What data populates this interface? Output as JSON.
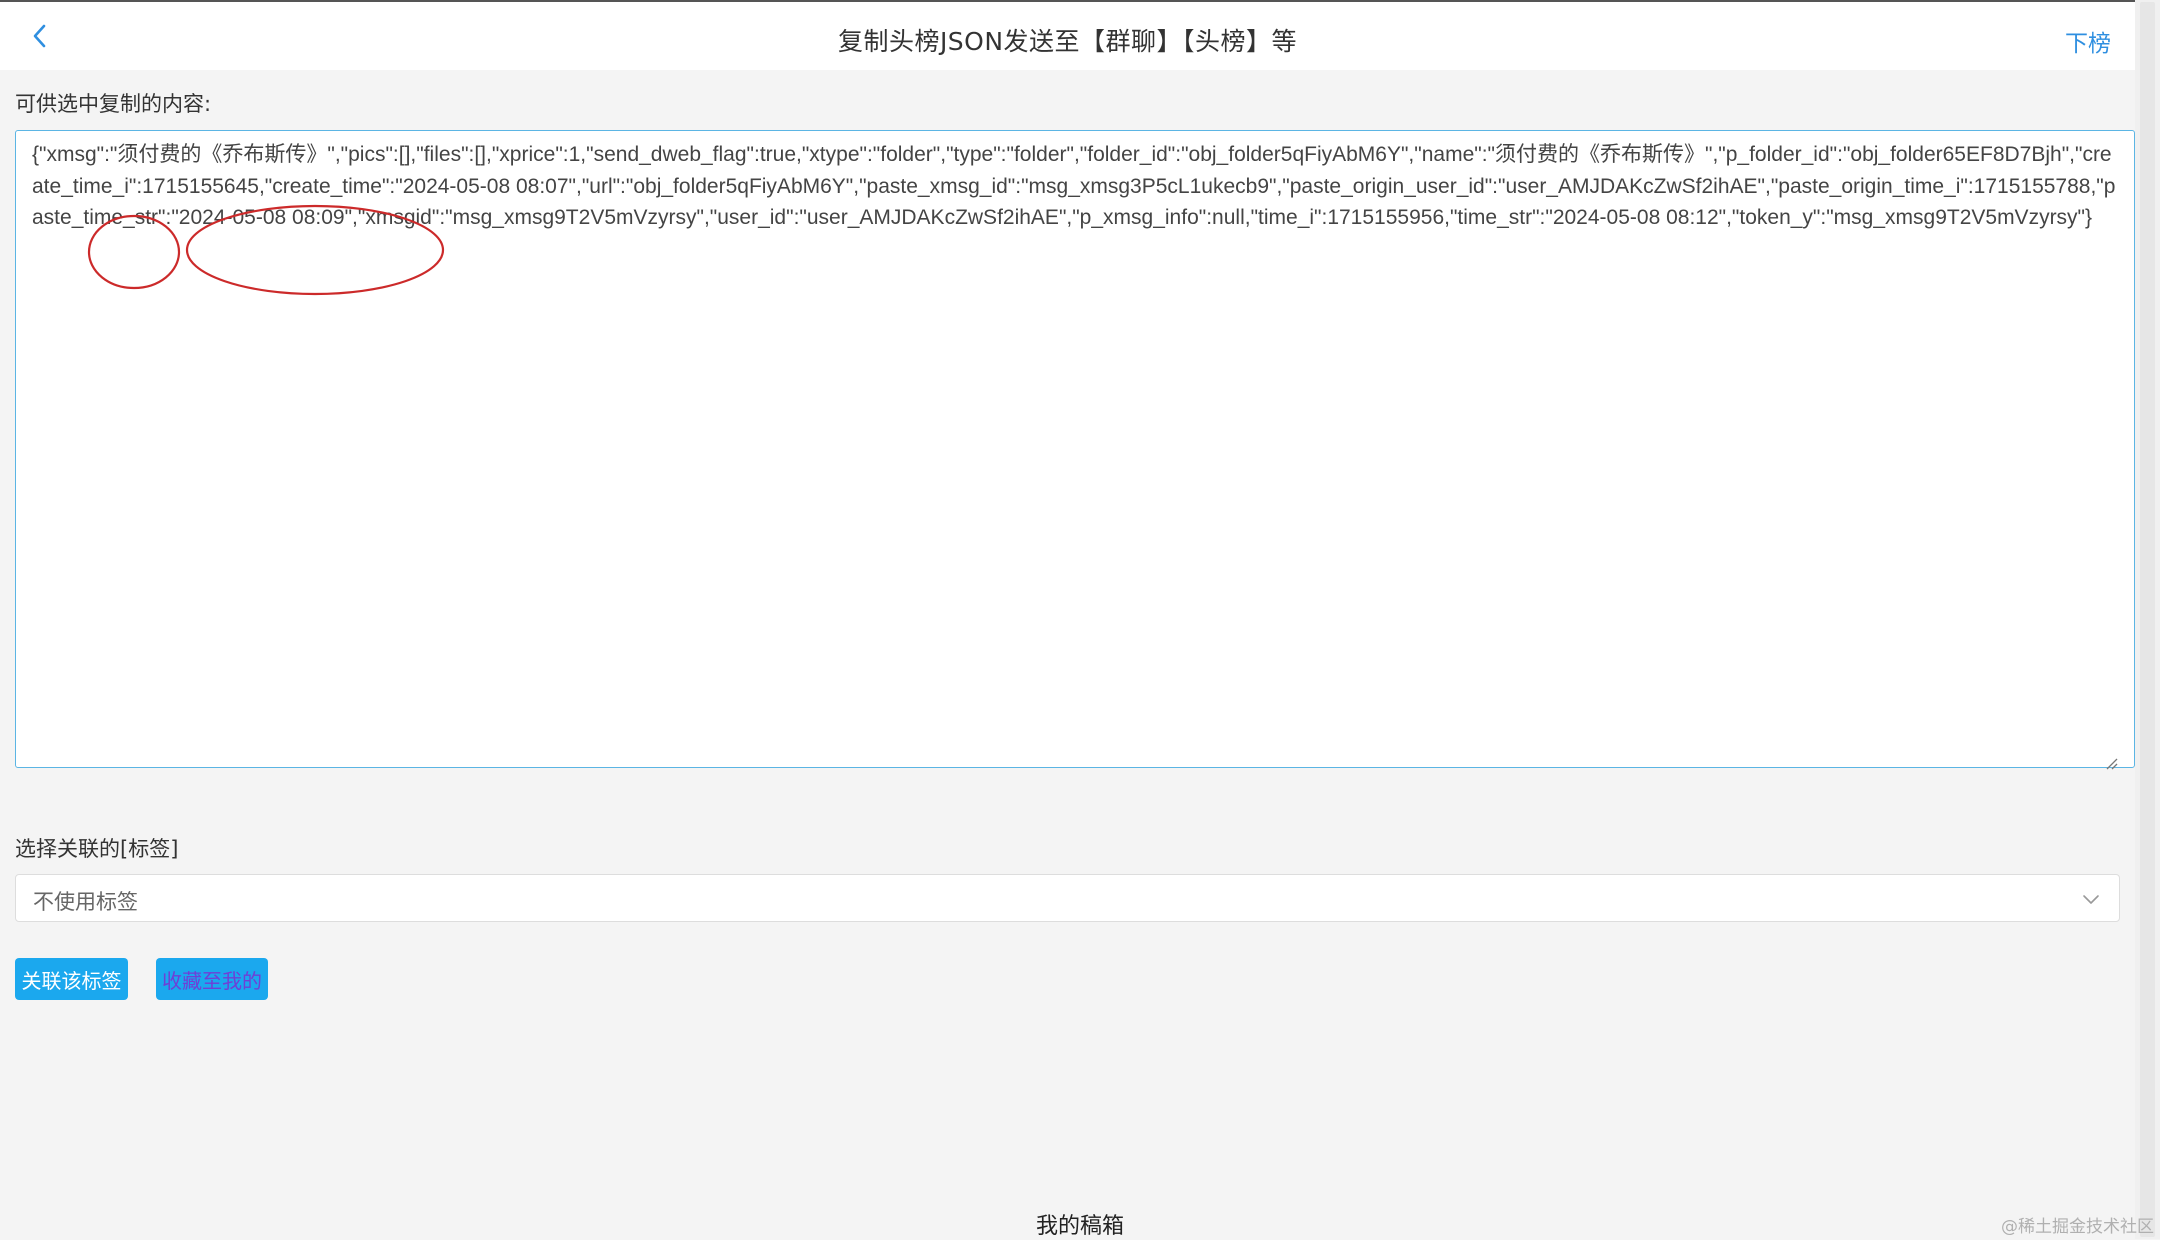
{
  "header": {
    "title": "复制头榜JSON发送至【群聊】【头榜】等",
    "right_action": "下榜"
  },
  "content": {
    "label": "可供选中复制的内容:",
    "json_text": "{\"xmsg\":\"须付费的《乔布斯传》\",\"pics\":[],\"files\":[],\"xprice\":1,\"send_dweb_flag\":true,\"xtype\":\"folder\",\"type\":\"folder\",\"folder_id\":\"obj_folder5qFiyAbM6Y\",\"name\":\"须付费的《乔布斯传》\",\"p_folder_id\":\"obj_folder65EF8D7Bjh\",\"create_time_i\":1715155645,\"create_time\":\"2024-05-08 08:07\",\"url\":\"obj_folder5qFiyAbM6Y\",\"paste_xmsg_id\":\"msg_xmsg3P5cL1ukecb9\",\"paste_origin_user_id\":\"user_AMJDAKcZwSf2ihAE\",\"paste_origin_time_i\":1715155788,\"paste_time_str\":\"2024-05-08 08:09\",\"xmsgid\":\"msg_xmsg9T2V5mVzyrsy\",\"user_id\":\"user_AMJDAKcZwSf2ihAE\",\"p_xmsg_info\":null,\"time_i\":1715155956,\"time_str\":\"2024-05-08 08:12\",\"token_y\":\"msg_xmsg9T2V5mVzyrsy\"}"
  },
  "tag": {
    "label": "选择关联的[标签]",
    "selected": "不使用标签"
  },
  "buttons": {
    "link_tag": "关联该标签",
    "save_mine": "收藏至我的"
  },
  "footer": {
    "title": "我的稿箱",
    "watermark": "@稀土掘金技术社区"
  },
  "colors": {
    "accent": "#1ba8ee",
    "link": "#2f8fe0",
    "annotation": "#cc2a2a"
  }
}
